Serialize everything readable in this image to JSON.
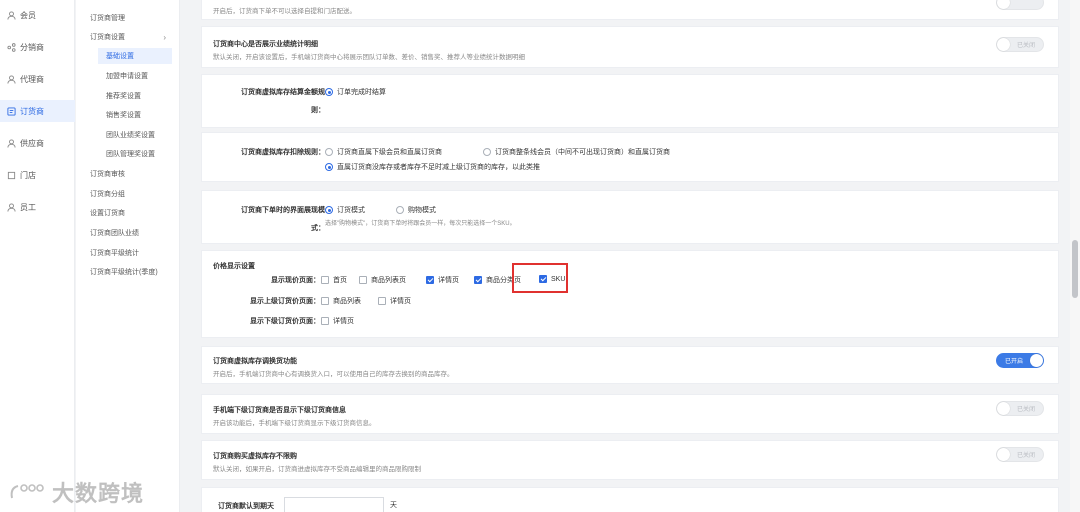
{
  "sidebar_primary": [
    {
      "label": "会员",
      "icon": "user-icon"
    },
    {
      "label": "分销商",
      "icon": "share-icon"
    },
    {
      "label": "代理商",
      "icon": "agent-icon"
    },
    {
      "label": "订货商",
      "icon": "order-icon",
      "active": true
    },
    {
      "label": "供应商",
      "icon": "supplier-icon"
    },
    {
      "label": "门店",
      "icon": "store-icon"
    },
    {
      "label": "员工",
      "icon": "staff-icon"
    }
  ],
  "sidebar_secondary": {
    "manage": "订货商管理",
    "settings": "订货商设置",
    "settings_children": [
      "基础设置",
      "加盟申请设置",
      "推荐奖设置",
      "销售奖设置",
      "团队业绩奖设置",
      "团队管理奖设置"
    ],
    "rest": [
      "订货商审核",
      "订货商分组",
      "设置订货商",
      "订货商团队业绩",
      "订货商平级统计",
      "订货商平级统计(季度)"
    ]
  },
  "cards": {
    "top_desc": "开启后，订货商下单不可以选择自提和门店配送。",
    "stats": {
      "title": "订货商中心是否展示业绩统计明细",
      "desc": "默认关闭，开启该设置后，手机端订货商中心将展示团队订单数、差价、销售奖、推荐人等业绩统计数据明细",
      "toggle": "已关闭"
    },
    "settle": {
      "label_line1": "订货商虚拟库存结算金额规",
      "label_line2": "则：",
      "option": "订单完成时结算"
    },
    "deduct": {
      "label": "订货商虚拟库存扣除规则：",
      "opt1": "订货商直属下级会员和直属订货商",
      "opt2": "订货商整条线会员（中间不可出现订货商）和直属订货商",
      "opt3": "直属订货商没库存或者库存不足时减上级订货商的库存，以此类推"
    },
    "display_mode": {
      "label_line1": "订货商下单时的界面展现模",
      "label_line2": "式：",
      "opt1": "订货模式",
      "opt2": "购物模式",
      "hint": "选择\"购物模式\"，订货商下单时将跟会员一样，每次只能选择一个SKU。"
    },
    "price": {
      "title": "价格显示设置",
      "row1_label": "显示现价页面：",
      "row1": [
        "首页",
        "商品列表页",
        "详情页",
        "商品分类页",
        "SKU"
      ],
      "row2_label": "显示上级订货价页面：",
      "row2": [
        "商品列表",
        "详情页"
      ],
      "row3_label": "显示下级订货价页面：",
      "row3": [
        "详情页"
      ]
    },
    "transfer": {
      "title": "订货商虚拟库存调换货功能",
      "desc": "开启后，手机端订货商中心有调换货入口，可以使用自己的库存去换别的商品库存。",
      "toggle": "已开启"
    },
    "sub_info": {
      "title": "手机端下级订货商是否显示下级订货商信息",
      "desc": "开启该功能后，手机端下级订货商显示下级订货商信息。",
      "toggle": "已关闭"
    },
    "no_limit": {
      "title": "订货商购买虚拟库存不限购",
      "desc": "默认关闭，如果开启，订货商进虚拟库存不受商品编辑里的商品限购限制",
      "toggle": "已关闭"
    },
    "expire": {
      "label": "订货商默认到期天",
      "unit": "天"
    }
  },
  "watermark": "大数跨境"
}
